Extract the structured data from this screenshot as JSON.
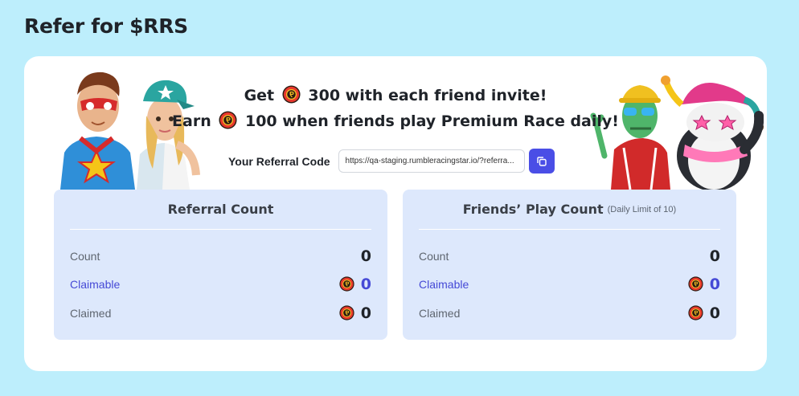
{
  "page": {
    "title": "Refer for $RRS"
  },
  "banner": {
    "line1_prefix": "Get",
    "line1_suffix": "300 with each friend invite!",
    "line2_prefix": "Earn",
    "line2_suffix": "100 when friends play Premium Race daily!",
    "coin_icon": "rrs-coin-icon"
  },
  "referral": {
    "label": "Your Referral Code",
    "value": "https://qa-staging.rumbleracingstar.io/?referra...",
    "copy_icon": "copy-icon"
  },
  "panels": [
    {
      "title": "Referral Count",
      "subtitle": "",
      "rows": [
        {
          "label": "Count",
          "value": "0"
        },
        {
          "label": "Claimable",
          "value": "0"
        },
        {
          "label": "Claimed",
          "value": "0"
        }
      ]
    },
    {
      "title": "Friends’ Play Count",
      "subtitle": "(Daily Limit of 10)",
      "rows": [
        {
          "label": "Count",
          "value": "0"
        },
        {
          "label": "Claimable",
          "value": "0"
        },
        {
          "label": "Claimed",
          "value": "0"
        }
      ]
    }
  ],
  "colors": {
    "background": "#bdeefc",
    "card": "#ffffff",
    "panel": "#dde8fc",
    "accent": "#4549d6",
    "button": "#4a4ee6",
    "coin": "#e03a2f"
  }
}
